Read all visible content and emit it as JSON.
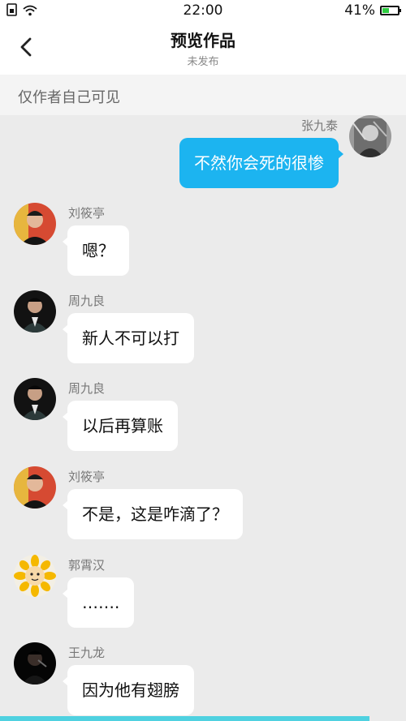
{
  "status_bar": {
    "time": "22:00",
    "battery": "41%"
  },
  "header": {
    "title": "预览作品",
    "subtitle": "未发布"
  },
  "visibility_notice": "仅作者自己可见",
  "messages": [
    {
      "side": "right",
      "name": "张九泰",
      "text": "不然你会死的很惨"
    },
    {
      "side": "left",
      "name": "刘筱亭",
      "text": "嗯？"
    },
    {
      "side": "left",
      "name": "周九良",
      "text": "新人不可以打"
    },
    {
      "side": "left",
      "name": "周九良",
      "text": "以后再算账"
    },
    {
      "side": "left",
      "name": "刘筱亭",
      "text": "不是，这是咋滴了？"
    },
    {
      "side": "left",
      "name": "郭霄汉",
      "text": "……."
    },
    {
      "side": "left",
      "name": "王九龙",
      "text": "因为他有翅膀"
    }
  ],
  "colors": {
    "accent_bubble": "#1cb4f0",
    "background": "#ebebeb",
    "bottom_accent": "#4fd1e0"
  }
}
